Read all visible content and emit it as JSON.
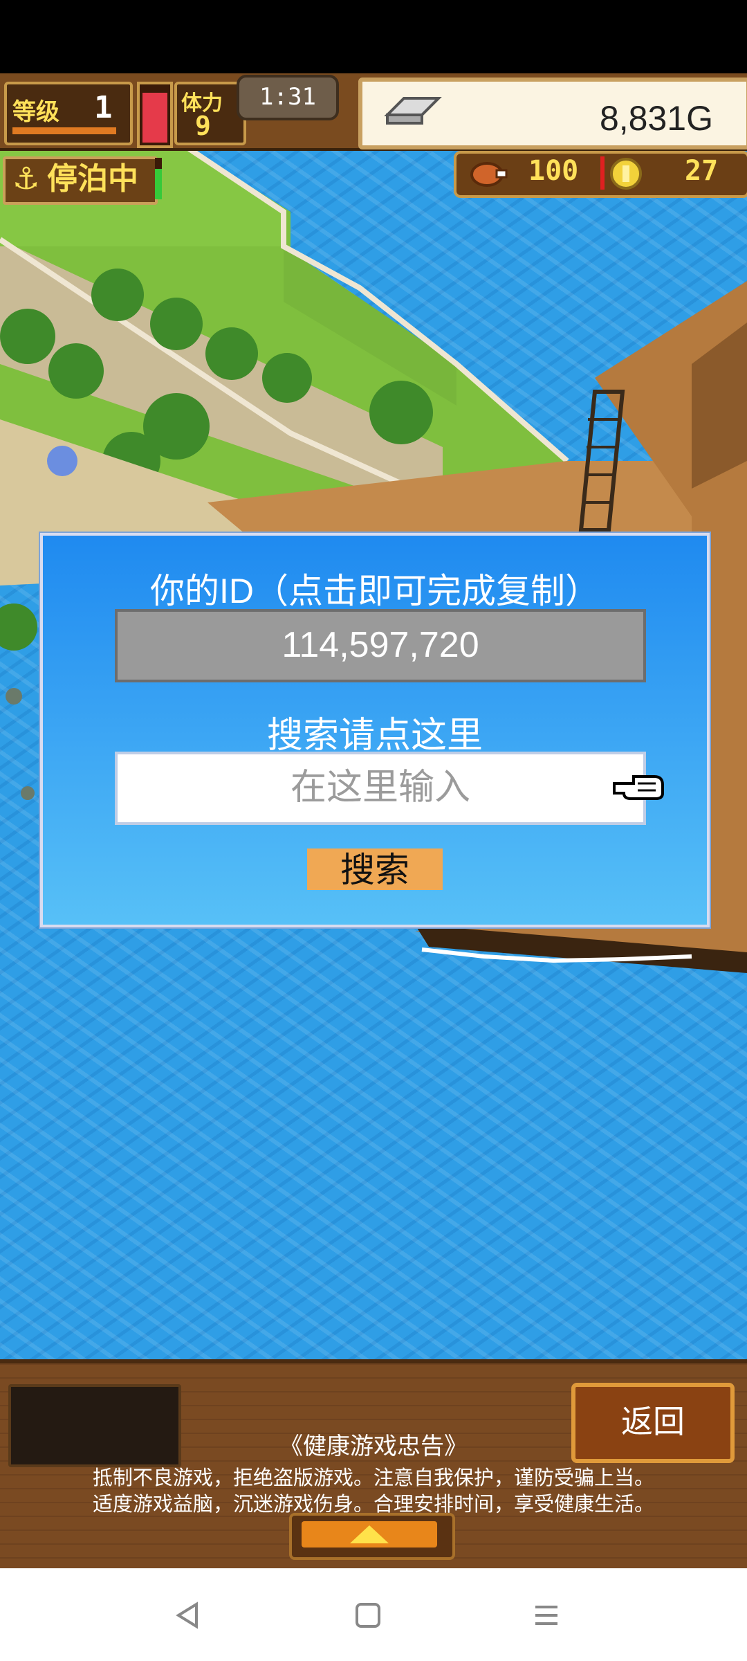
{
  "hud": {
    "level_label": "等级",
    "level_value": "1",
    "stamina_label": "体力",
    "stamina_value": "9",
    "timer": "1:31",
    "gold": "8,831G",
    "status_badge": "停泊中",
    "food_value": "100",
    "coin_value": "27",
    "stamina_fill": 0.9
  },
  "dialog": {
    "title": "你的ID（点击即可完成复制）",
    "player_id": "114,597,720",
    "search_heading": "搜索请点这里",
    "search_placeholder": "在这里输入",
    "search_button": "搜索"
  },
  "footer": {
    "back_button": "返回",
    "advisory_title": "《健康游戏忠告》",
    "advisory_line1": "抵制不良游戏，拒绝盗版游戏。注意自我保护，谨防受骗上当。",
    "advisory_line2": "适度游戏益脑，沉迷游戏伤身。合理安排时间，享受健康生活。"
  },
  "icons": {
    "gold": "gold-bar-icon",
    "anchor": "anchor-icon",
    "food": "meat-icon",
    "coin": "coin-icon",
    "pointer": "pointing-hand-icon",
    "expand": "triangle-up-icon"
  },
  "colors": {
    "sea": "#2f9ee6",
    "dialog_top": "#1f8af0",
    "dialog_bottom": "#57c0f7",
    "search_button": "#f0a854",
    "hud_text": "#ffe15a"
  }
}
